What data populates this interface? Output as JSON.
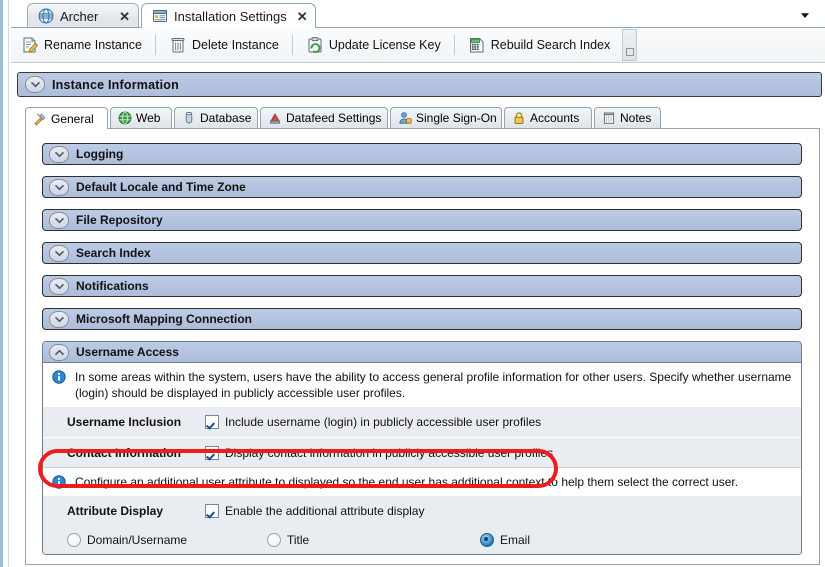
{
  "window": {
    "tabs": [
      {
        "label": "Archer",
        "icon": "globe-icon",
        "active": false,
        "close": "✕"
      },
      {
        "label": "Installation Settings",
        "icon": "form-window-icon",
        "active": true,
        "close": "✕"
      }
    ],
    "tabstrip_dropdown_icon": "chevron-down-icon"
  },
  "toolbar": {
    "buttons": [
      {
        "label": "Rename Instance",
        "icon": "document-pencil-icon"
      },
      {
        "label": "Delete Instance",
        "icon": "trash-can-icon"
      },
      {
        "label": "Update License Key",
        "icon": "clipboard-refresh-icon"
      },
      {
        "label": "Rebuild Search Index",
        "icon": "calculator-grid-icon"
      }
    ],
    "overflow_icon": "toolbar-overflow-icon"
  },
  "banner": {
    "title": "Instance Information",
    "chevron": "chevron-down-icon"
  },
  "inner_tabs": [
    {
      "label": "General",
      "icon": "tools-icon",
      "active": true
    },
    {
      "label": "Web",
      "icon": "globe-icon",
      "active": false
    },
    {
      "label": "Database",
      "icon": "database-cylinder-icon",
      "active": false
    },
    {
      "label": "Datafeed Settings",
      "icon": "datafeed-icon",
      "active": false
    },
    {
      "label": "Single Sign-On",
      "icon": "user-key-icon",
      "active": false
    },
    {
      "label": "Accounts",
      "icon": "padlock-icon",
      "active": false
    },
    {
      "label": "Notes",
      "icon": "notepad-icon",
      "active": false
    }
  ],
  "sections": [
    {
      "title": "Logging",
      "chevron": "chevron-down-icon",
      "expanded": false
    },
    {
      "title": "Default Locale and Time Zone",
      "chevron": "chevron-down-icon",
      "expanded": false
    },
    {
      "title": "File Repository",
      "chevron": "chevron-down-icon",
      "expanded": false
    },
    {
      "title": "Search Index",
      "chevron": "chevron-down-icon",
      "expanded": false
    },
    {
      "title": "Notifications",
      "chevron": "chevron-down-icon",
      "expanded": false
    },
    {
      "title": "Microsoft Mapping Connection",
      "chevron": "chevron-down-icon",
      "expanded": false
    }
  ],
  "username_access": {
    "title": "Username Access",
    "chevron": "chevron-up-icon",
    "info_text": "In some areas within the system, users have the ability to access general profile information for other users. Specify whether username (login) should be displayed in publicly accessible user profiles.",
    "info_icon": "info-icon",
    "username_inclusion": {
      "label": "Username Inclusion",
      "checkbox_text": "Include username (login) in publicly accessible user profiles",
      "checked": true
    },
    "contact_information": {
      "label": "Contact Information",
      "checkbox_text": "Display contact information in publicly accessible user profiles",
      "checked": true,
      "highlighted": true
    },
    "attribute_info_text": "Configure an additional user attribute to displayed so the end user has additional context to help them select the correct user.",
    "attribute_info_icon": "info-icon",
    "attribute_display": {
      "label": "Attribute Display",
      "checkbox_text": "Enable the additional attribute display",
      "checked": true,
      "options": [
        {
          "label": "Domain/Username",
          "selected": false
        },
        {
          "label": "Title",
          "selected": false
        },
        {
          "label": "Email",
          "selected": true
        }
      ]
    }
  },
  "colors": {
    "section_header": "#b3c2dd",
    "field_background": "#e9edf2",
    "annotation_red": "#ee1c1c",
    "accent_blue": "#1b76b5"
  }
}
